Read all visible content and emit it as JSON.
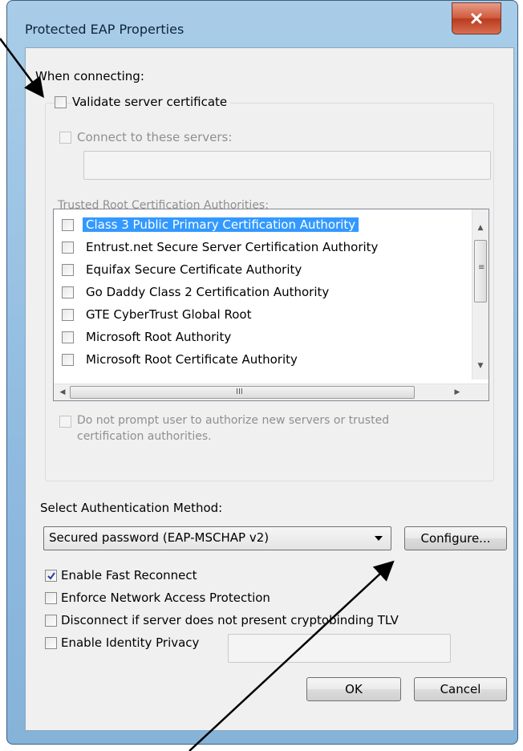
{
  "window": {
    "title": "Protected EAP Properties",
    "close_glyph": "close-x-icon"
  },
  "when_connecting": {
    "heading": "When connecting:",
    "validate_server_certificate": {
      "label": "Validate server certificate",
      "checked": false
    },
    "connect_to_servers": {
      "label": "Connect to these servers:",
      "checked": false,
      "value": ""
    },
    "trusted_root_label": "Trusted Root Certification Authorities:",
    "authorities": [
      {
        "name": "Class 3 Public Primary Certification Authority",
        "checked": false,
        "selected": true
      },
      {
        "name": "Entrust.net Secure Server Certification Authority",
        "checked": false,
        "selected": false
      },
      {
        "name": "Equifax Secure Certificate Authority",
        "checked": false,
        "selected": false
      },
      {
        "name": "Go Daddy Class 2 Certification Authority",
        "checked": false,
        "selected": false
      },
      {
        "name": "GTE CyberTrust Global Root",
        "checked": false,
        "selected": false
      },
      {
        "name": "Microsoft Root Authority",
        "checked": false,
        "selected": false
      },
      {
        "name": "Microsoft Root Certificate Authority",
        "checked": false,
        "selected": false
      }
    ],
    "hscroll_grip": "III",
    "do_not_prompt": {
      "line1": "Do not prompt user to authorize new servers or trusted",
      "line2": "certification authorities.",
      "checked": false
    }
  },
  "auth": {
    "label": "Select Authentication Method:",
    "selected_method": "Secured password (EAP-MSCHAP v2)",
    "configure_label": "Configure..."
  },
  "options": {
    "enable_fast_reconnect": {
      "label": "Enable Fast Reconnect",
      "checked": true
    },
    "enforce_nap": {
      "label": "Enforce Network Access Protection",
      "checked": false
    },
    "disconnect_cryptobinding": {
      "label": "Disconnect if server does not present cryptobinding TLV",
      "checked": false
    },
    "identity_privacy": {
      "label": "Enable Identity Privacy",
      "checked": false,
      "value": ""
    }
  },
  "buttons": {
    "ok": "OK",
    "cancel": "Cancel"
  },
  "colors": {
    "selection": "#3399ff",
    "frame": "#8fbbe0",
    "close": "#cf5b3e"
  }
}
